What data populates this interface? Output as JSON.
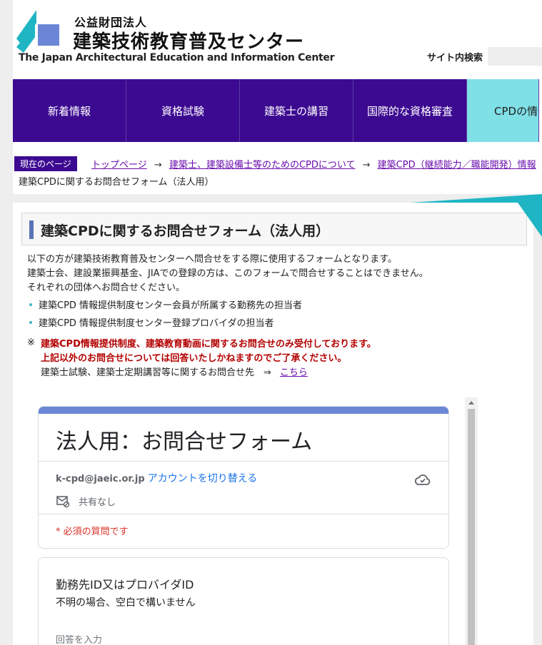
{
  "header": {
    "org_type": "公益財団法人",
    "org_name": "建築技術教育普及センター",
    "org_name_en": "The Japan Architectural Education and Information Center",
    "site_search_label": "サイト内検索",
    "logo_icon": "jaeic-logo-icon"
  },
  "nav": {
    "items": [
      {
        "label": "新着情報"
      },
      {
        "label": "資格試験"
      },
      {
        "label": "建築士の講習"
      },
      {
        "label": "国際的な資格審査"
      },
      {
        "label": "CPDの情"
      }
    ],
    "color": "#3c0a91",
    "active_color": "#7fe0e6"
  },
  "breadcrumb": {
    "here_label": "現在のページ",
    "links": [
      {
        "label": "トップページ"
      },
      {
        "label": "建築士、建築設備士等のためのCPDについて"
      },
      {
        "label": "建築CPD（継続能力／職能開発）情報"
      }
    ],
    "separator": "→",
    "current": "建築CPDに関するお問合せフォーム（法人用）"
  },
  "page": {
    "title": "建築CPDに関するお問合せフォーム（法人用）",
    "intro": [
      "以下の方が建築技術教育普及センターへ問合せをする際に使用するフォームとなります。",
      "建築士会、建設業振興基金、JIAでの登録の方は、このフォームで問合せすることはできません。",
      "それぞれの団体へお問合せください。"
    ],
    "bullets": [
      "建築CPD 情報提供制度センター会員が所属する勤務先の担当者",
      "建築CPD 情報提供制度センター登録プロバイダの担当者"
    ],
    "note_mark": "※",
    "notice": [
      "建築CPD情報提供制度、建築教育動画に関するお問合せのみ受付しております。",
      "上記以外のお問合せについては回答いたしかねますのでご了承ください。"
    ],
    "other_inquiry": "建築士試験、建築士定期講習等に関するお問合せ先　⇒",
    "other_inquiry_link": "こちら"
  },
  "form": {
    "title": "法人用：お問合せフォーム",
    "account_email": "k-cpd@jaeic.or.jp",
    "switch_account": "アカウントを切り替える",
    "not_shared": "共有なし",
    "required_note": "* 必須の質問です",
    "question_title": "勤務先ID又はプロバイダID",
    "question_desc": "不明の場合、空白で構いません",
    "answer_placeholder": "回答を入力",
    "accent": "#6a88d6"
  }
}
